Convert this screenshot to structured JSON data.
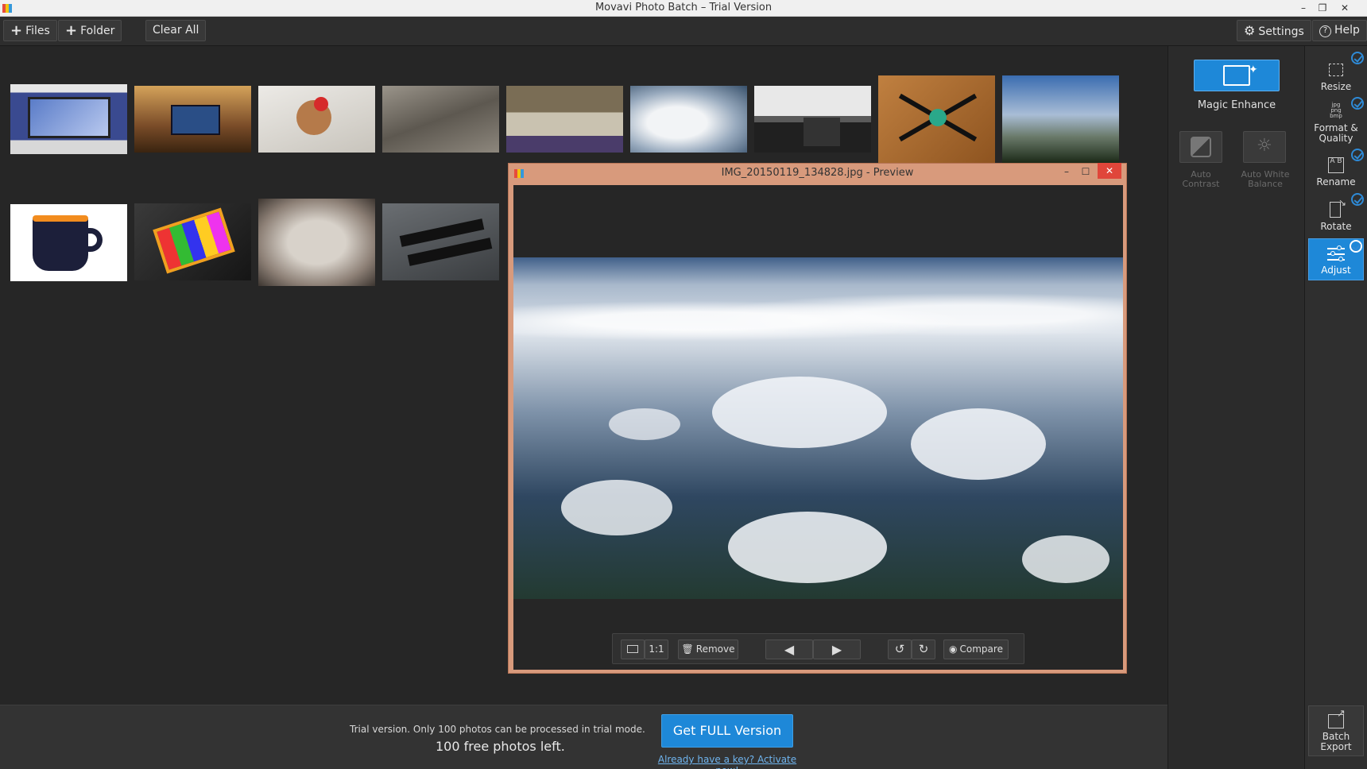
{
  "window": {
    "title": "Movavi Photo Batch – Trial Version"
  },
  "toolbar": {
    "files_label": "Files",
    "folder_label": "Folder",
    "clear_all_label": "Clear All",
    "settings_label": "Settings",
    "help_label": "Help"
  },
  "tools": {
    "magic_enhance_label": "Magic Enhance",
    "auto_contrast_label": "Auto Contrast",
    "auto_white_balance_label": "Auto White Balance"
  },
  "rail": {
    "resize_label": "Resize",
    "format_label": "Format & Quality",
    "rename_label": "Rename",
    "rotate_label": "Rotate",
    "adjust_label": "Adjust",
    "batch_export_label": "Batch Export"
  },
  "preview": {
    "title": "IMG_20150119_134828.jpg - Preview",
    "one_to_one_label": "1:1",
    "remove_label": "Remove",
    "compare_label": "Compare"
  },
  "bottom": {
    "trial_message": "Trial version. Only 100 photos can be processed in trial mode.",
    "photos_left": "100 free photos left.",
    "get_full_label": "Get FULL Version",
    "activate_link": "Already have a key? Activate now!"
  },
  "colors": {
    "accent": "#1e88d8",
    "preview_border": "#d89a7c"
  }
}
